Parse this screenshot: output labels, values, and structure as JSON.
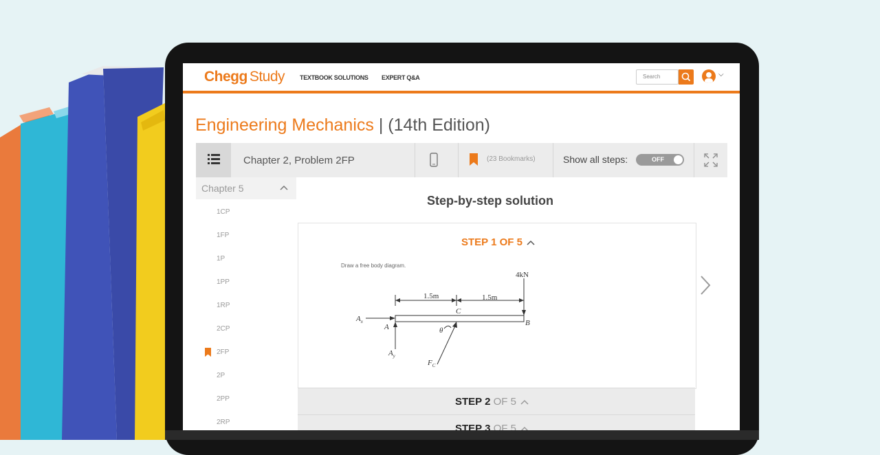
{
  "header": {
    "logo_brand": "Chegg",
    "logo_product": "Study",
    "nav": [
      "TEXTBOOK SOLUTIONS",
      "EXPERT Q&A"
    ],
    "search_placeholder": "Search"
  },
  "book": {
    "title": "Engineering Mechanics",
    "edition": "| (14th Edition)"
  },
  "toolbar": {
    "chapter_problem": "Chapter 2, Problem 2FP",
    "bookmarks": "(23 Bookmarks)",
    "show_all_label": "Show all steps:",
    "toggle_state": "OFF"
  },
  "sidebar": {
    "chapter": "Chapter 5",
    "items": [
      "1CP",
      "1FP",
      "1P",
      "1PP",
      "1RP",
      "2CP",
      "2FP",
      "2P",
      "2PP",
      "2RP"
    ],
    "active": "2FP"
  },
  "solution": {
    "heading": "Step-by-step solution",
    "step1_label": "STEP 1 OF 5",
    "step1_text": "Draw a free body diagram.",
    "step2_bold": "STEP 2",
    "step2_rest": " OF 5",
    "step3_bold": "STEP 3",
    "step3_rest": " OF 5"
  },
  "diagram": {
    "load": "4kN",
    "dim1": "1.5m",
    "dim2": "1.5m",
    "labels": [
      "Ax",
      "A",
      "Ay",
      "C",
      "B",
      "θ",
      "Fc"
    ]
  },
  "colors": {
    "accent": "#ec7a1b",
    "background": "#e6f3f5"
  }
}
